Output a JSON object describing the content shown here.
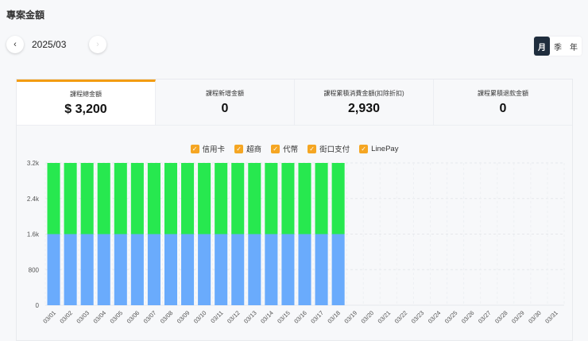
{
  "header": {
    "title": "專案金額",
    "month": "2025/03",
    "prev_icon": "‹",
    "next_icon": "›"
  },
  "period": {
    "options": [
      "月",
      "季",
      "年"
    ],
    "selected": "月"
  },
  "cards": [
    {
      "label": "課程總金額",
      "value": "$ 3,200"
    },
    {
      "label": "課程新增金額",
      "value": "0"
    },
    {
      "label": "課程累積消費金額(扣除折扣)",
      "value": "2,930"
    },
    {
      "label": "課程累積退款金額",
      "value": "0"
    }
  ],
  "chart_data": {
    "type": "bar",
    "stacked": true,
    "categories": [
      "03/01",
      "03/02",
      "03/03",
      "03/04",
      "03/05",
      "03/06",
      "03/07",
      "03/08",
      "03/09",
      "03/10",
      "03/11",
      "03/12",
      "03/13",
      "03/14",
      "03/15",
      "03/16",
      "03/17",
      "03/18",
      "03/19",
      "03/20",
      "03/21",
      "03/22",
      "03/23",
      "03/24",
      "03/25",
      "03/26",
      "03/27",
      "03/28",
      "03/29",
      "03/30",
      "03/31"
    ],
    "series": [
      {
        "name": "信用卡",
        "color": "#6aabfc",
        "values": [
          1600,
          1600,
          1600,
          1600,
          1600,
          1600,
          1600,
          1600,
          1600,
          1600,
          1600,
          1600,
          1600,
          1600,
          1600,
          1600,
          1600,
          1600,
          0,
          0,
          0,
          0,
          0,
          0,
          0,
          0,
          0,
          0,
          0,
          0,
          0
        ]
      },
      {
        "name": "超商",
        "color": "#27e84f",
        "values": [
          1600,
          1600,
          1600,
          1600,
          1600,
          1600,
          1600,
          1600,
          1600,
          1600,
          1600,
          1600,
          1600,
          1600,
          1600,
          1600,
          1600,
          1600,
          0,
          0,
          0,
          0,
          0,
          0,
          0,
          0,
          0,
          0,
          0,
          0,
          0
        ]
      },
      {
        "name": "代幣",
        "color": "#f5a623",
        "values": [
          0,
          0,
          0,
          0,
          0,
          0,
          0,
          0,
          0,
          0,
          0,
          0,
          0,
          0,
          0,
          0,
          0,
          0,
          0,
          0,
          0,
          0,
          0,
          0,
          0,
          0,
          0,
          0,
          0,
          0,
          0
        ]
      },
      {
        "name": "街口支付",
        "color": "#f5a623",
        "values": [
          0,
          0,
          0,
          0,
          0,
          0,
          0,
          0,
          0,
          0,
          0,
          0,
          0,
          0,
          0,
          0,
          0,
          0,
          0,
          0,
          0,
          0,
          0,
          0,
          0,
          0,
          0,
          0,
          0,
          0,
          0
        ]
      },
      {
        "name": "LinePay",
        "color": "#f5a623",
        "values": [
          0,
          0,
          0,
          0,
          0,
          0,
          0,
          0,
          0,
          0,
          0,
          0,
          0,
          0,
          0,
          0,
          0,
          0,
          0,
          0,
          0,
          0,
          0,
          0,
          0,
          0,
          0,
          0,
          0,
          0,
          0
        ]
      }
    ],
    "yticks": [
      "0",
      "800",
      "1.6k",
      "2.4k",
      "3.2k"
    ],
    "ytick_values": [
      0,
      800,
      1600,
      2400,
      3200
    ],
    "ylim": [
      0,
      3200
    ],
    "legend": "top-center",
    "grid": true
  }
}
